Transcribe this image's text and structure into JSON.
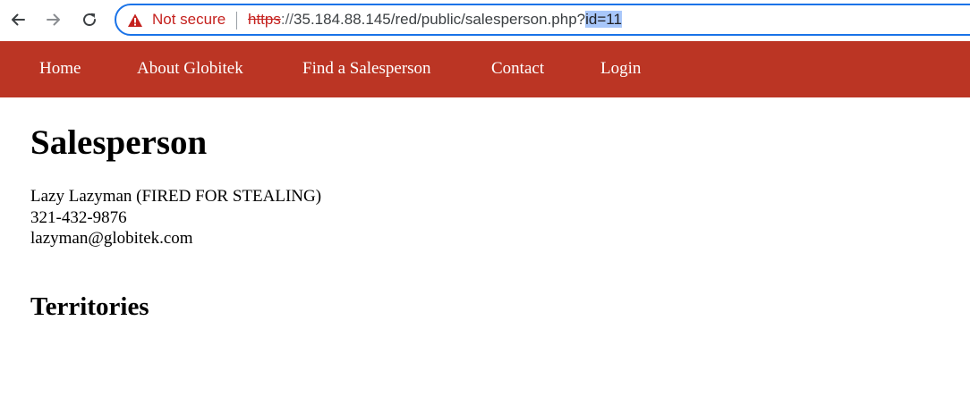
{
  "browser": {
    "security_label": "Not secure",
    "url": {
      "scheme": "https",
      "separator": "://",
      "path": "35.184.88.145/red/public/salesperson.php?",
      "selected": "id=11"
    }
  },
  "site_nav": {
    "items": [
      {
        "label": "Home"
      },
      {
        "label": "About Globitek"
      },
      {
        "label": "Find a Salesperson"
      },
      {
        "label": "Contact"
      },
      {
        "label": "Login"
      }
    ]
  },
  "page": {
    "title": "Salesperson",
    "salesperson": {
      "name": "Lazy Lazyman (FIRED FOR STEALING)",
      "phone": "321-432-9876",
      "email": "lazyman@globitek.com"
    },
    "territories_title": "Territories"
  },
  "colors": {
    "nav_background": "#bb3524",
    "omnibox_focus_border": "#1a73e8",
    "insecure_red": "#c5221f",
    "url_selection": "#a8c7fa"
  },
  "icons": {
    "back": "arrow-left-icon",
    "forward": "arrow-right-icon",
    "reload": "reload-icon",
    "security": "warning-triangle-icon"
  }
}
